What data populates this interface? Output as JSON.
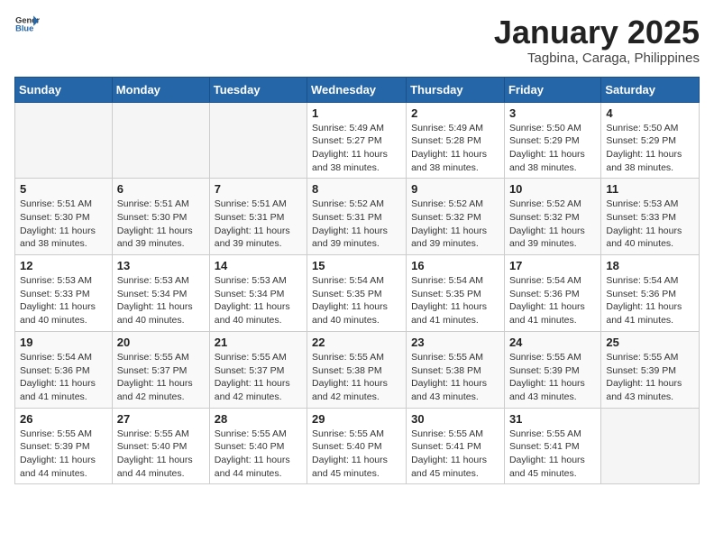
{
  "header": {
    "logo_general": "General",
    "logo_blue": "Blue",
    "title": "January 2025",
    "subtitle": "Tagbina, Caraga, Philippines"
  },
  "weekdays": [
    "Sunday",
    "Monday",
    "Tuesday",
    "Wednesday",
    "Thursday",
    "Friday",
    "Saturday"
  ],
  "weeks": [
    [
      {
        "day": "",
        "info": ""
      },
      {
        "day": "",
        "info": ""
      },
      {
        "day": "",
        "info": ""
      },
      {
        "day": "1",
        "info": "Sunrise: 5:49 AM\nSunset: 5:27 PM\nDaylight: 11 hours\nand 38 minutes."
      },
      {
        "day": "2",
        "info": "Sunrise: 5:49 AM\nSunset: 5:28 PM\nDaylight: 11 hours\nand 38 minutes."
      },
      {
        "day": "3",
        "info": "Sunrise: 5:50 AM\nSunset: 5:29 PM\nDaylight: 11 hours\nand 38 minutes."
      },
      {
        "day": "4",
        "info": "Sunrise: 5:50 AM\nSunset: 5:29 PM\nDaylight: 11 hours\nand 38 minutes."
      }
    ],
    [
      {
        "day": "5",
        "info": "Sunrise: 5:51 AM\nSunset: 5:30 PM\nDaylight: 11 hours\nand 38 minutes."
      },
      {
        "day": "6",
        "info": "Sunrise: 5:51 AM\nSunset: 5:30 PM\nDaylight: 11 hours\nand 39 minutes."
      },
      {
        "day": "7",
        "info": "Sunrise: 5:51 AM\nSunset: 5:31 PM\nDaylight: 11 hours\nand 39 minutes."
      },
      {
        "day": "8",
        "info": "Sunrise: 5:52 AM\nSunset: 5:31 PM\nDaylight: 11 hours\nand 39 minutes."
      },
      {
        "day": "9",
        "info": "Sunrise: 5:52 AM\nSunset: 5:32 PM\nDaylight: 11 hours\nand 39 minutes."
      },
      {
        "day": "10",
        "info": "Sunrise: 5:52 AM\nSunset: 5:32 PM\nDaylight: 11 hours\nand 39 minutes."
      },
      {
        "day": "11",
        "info": "Sunrise: 5:53 AM\nSunset: 5:33 PM\nDaylight: 11 hours\nand 40 minutes."
      }
    ],
    [
      {
        "day": "12",
        "info": "Sunrise: 5:53 AM\nSunset: 5:33 PM\nDaylight: 11 hours\nand 40 minutes."
      },
      {
        "day": "13",
        "info": "Sunrise: 5:53 AM\nSunset: 5:34 PM\nDaylight: 11 hours\nand 40 minutes."
      },
      {
        "day": "14",
        "info": "Sunrise: 5:53 AM\nSunset: 5:34 PM\nDaylight: 11 hours\nand 40 minutes."
      },
      {
        "day": "15",
        "info": "Sunrise: 5:54 AM\nSunset: 5:35 PM\nDaylight: 11 hours\nand 40 minutes."
      },
      {
        "day": "16",
        "info": "Sunrise: 5:54 AM\nSunset: 5:35 PM\nDaylight: 11 hours\nand 41 minutes."
      },
      {
        "day": "17",
        "info": "Sunrise: 5:54 AM\nSunset: 5:36 PM\nDaylight: 11 hours\nand 41 minutes."
      },
      {
        "day": "18",
        "info": "Sunrise: 5:54 AM\nSunset: 5:36 PM\nDaylight: 11 hours\nand 41 minutes."
      }
    ],
    [
      {
        "day": "19",
        "info": "Sunrise: 5:54 AM\nSunset: 5:36 PM\nDaylight: 11 hours\nand 41 minutes."
      },
      {
        "day": "20",
        "info": "Sunrise: 5:55 AM\nSunset: 5:37 PM\nDaylight: 11 hours\nand 42 minutes."
      },
      {
        "day": "21",
        "info": "Sunrise: 5:55 AM\nSunset: 5:37 PM\nDaylight: 11 hours\nand 42 minutes."
      },
      {
        "day": "22",
        "info": "Sunrise: 5:55 AM\nSunset: 5:38 PM\nDaylight: 11 hours\nand 42 minutes."
      },
      {
        "day": "23",
        "info": "Sunrise: 5:55 AM\nSunset: 5:38 PM\nDaylight: 11 hours\nand 43 minutes."
      },
      {
        "day": "24",
        "info": "Sunrise: 5:55 AM\nSunset: 5:39 PM\nDaylight: 11 hours\nand 43 minutes."
      },
      {
        "day": "25",
        "info": "Sunrise: 5:55 AM\nSunset: 5:39 PM\nDaylight: 11 hours\nand 43 minutes."
      }
    ],
    [
      {
        "day": "26",
        "info": "Sunrise: 5:55 AM\nSunset: 5:39 PM\nDaylight: 11 hours\nand 44 minutes."
      },
      {
        "day": "27",
        "info": "Sunrise: 5:55 AM\nSunset: 5:40 PM\nDaylight: 11 hours\nand 44 minutes."
      },
      {
        "day": "28",
        "info": "Sunrise: 5:55 AM\nSunset: 5:40 PM\nDaylight: 11 hours\nand 44 minutes."
      },
      {
        "day": "29",
        "info": "Sunrise: 5:55 AM\nSunset: 5:40 PM\nDaylight: 11 hours\nand 45 minutes."
      },
      {
        "day": "30",
        "info": "Sunrise: 5:55 AM\nSunset: 5:41 PM\nDaylight: 11 hours\nand 45 minutes."
      },
      {
        "day": "31",
        "info": "Sunrise: 5:55 AM\nSunset: 5:41 PM\nDaylight: 11 hours\nand 45 minutes."
      },
      {
        "day": "",
        "info": ""
      }
    ]
  ]
}
